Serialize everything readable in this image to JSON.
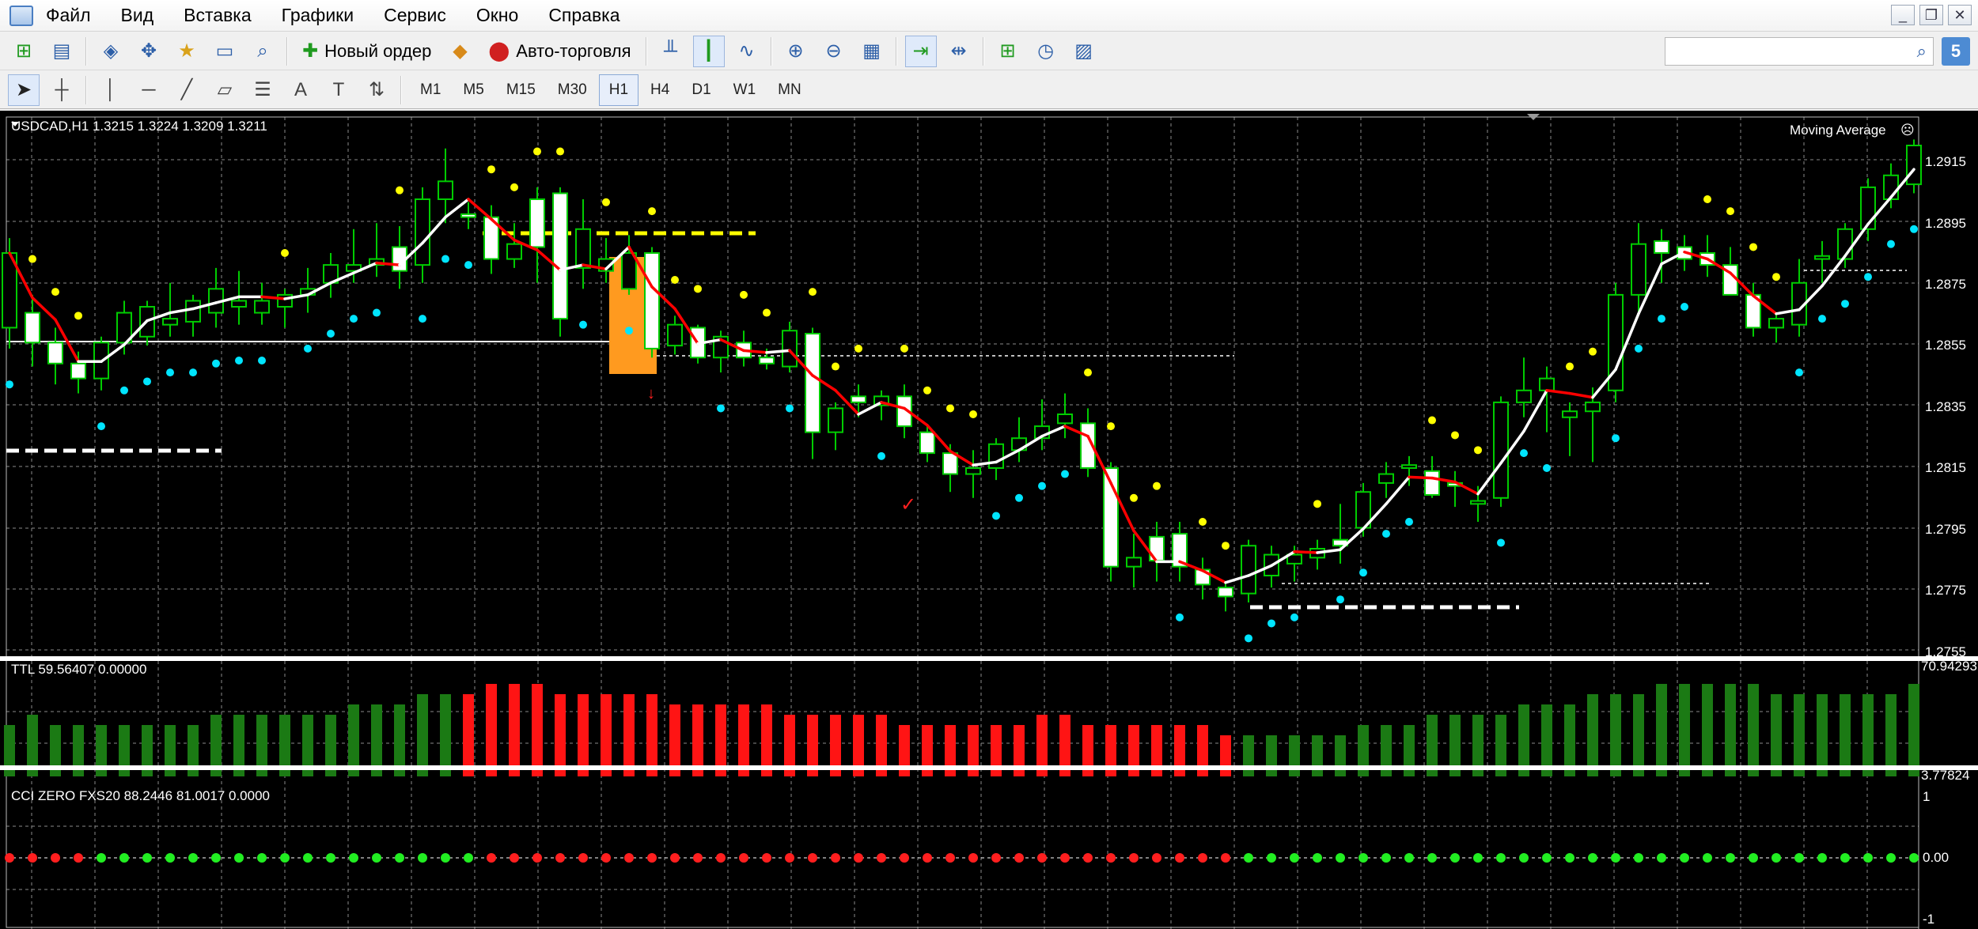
{
  "menu": [
    "Файл",
    "Вид",
    "Вставка",
    "Графики",
    "Сервис",
    "Окно",
    "Справка"
  ],
  "window_controls": [
    "_",
    "❐",
    "✕"
  ],
  "toolbar": {
    "new_order_label": "Новый ордер",
    "auto_trading_label": "Авто-торговля",
    "search_placeholder": "",
    "community_label": "5"
  },
  "timeframes": [
    "M1",
    "M5",
    "M15",
    "M30",
    "H1",
    "H4",
    "D1",
    "W1",
    "MN"
  ],
  "active_timeframe": "H1",
  "chart": {
    "info_label": "USDCAD,H1  1.3215 1.3224 1.3209 1.3211",
    "indicator_label": "Moving Average",
    "price_labels": [
      "1.2915",
      "1.2895",
      "1.2875",
      "1.2855",
      "1.2835",
      "1.2815",
      "1.2795",
      "1.2775",
      "1.2755"
    ],
    "ttl_label": "TTL 59.56407 0.00000",
    "ttl_scale_top": "70.94293",
    "ttl_scale_bottom": "3.77824",
    "cci_label": "CCI ZERO FXS20 88.2446 81.0017 0.0000",
    "cci_scale": [
      "1",
      "0.00",
      "-1"
    ]
  },
  "colors": {
    "bull_body": "#000000",
    "bear_body": "#ffffff",
    "candle_outline": "#00cc00",
    "ma_up": "#ffffff",
    "ma_down": "#ff0000",
    "psar_low": "#00e5ff",
    "psar_high": "#ffff00",
    "hist_green": "#1b7a14",
    "hist_red": "#ff1414",
    "highlight": "#ff9a1f",
    "grid": "#8a8a8a"
  },
  "chart_data": {
    "type": "candlestick",
    "symbol": "USDCAD",
    "timeframe": "H1",
    "price_range": [
      1.2745,
      1.2925
    ],
    "candles": [
      [
        1.2855,
        1.2885,
        1.2848,
        1.288
      ],
      [
        1.286,
        1.2866,
        1.2842,
        1.285
      ],
      [
        1.285,
        1.2855,
        1.2836,
        1.2843
      ],
      [
        1.2843,
        1.2847,
        1.2833,
        1.2838
      ],
      [
        1.2838,
        1.2852,
        1.2834,
        1.285
      ],
      [
        1.285,
        1.2864,
        1.2846,
        1.286
      ],
      [
        1.2852,
        1.2864,
        1.2849,
        1.2862
      ],
      [
        1.2856,
        1.287,
        1.2852,
        1.2858
      ],
      [
        1.2857,
        1.2866,
        1.2852,
        1.2864
      ],
      [
        1.286,
        1.2875,
        1.2855,
        1.2868
      ],
      [
        1.2862,
        1.2874,
        1.2856,
        1.2864
      ],
      [
        1.286,
        1.287,
        1.2856,
        1.2864
      ],
      [
        1.2862,
        1.2868,
        1.2855,
        1.2866
      ],
      [
        1.2866,
        1.2875,
        1.286,
        1.2868
      ],
      [
        1.287,
        1.288,
        1.2865,
        1.2876
      ],
      [
        1.2874,
        1.2888,
        1.287,
        1.2876
      ],
      [
        1.2876,
        1.289,
        1.2872,
        1.2878
      ],
      [
        1.2882,
        1.2889,
        1.2868,
        1.2874
      ],
      [
        1.2876,
        1.2902,
        1.287,
        1.2898
      ],
      [
        1.2898,
        1.2915,
        1.289,
        1.2904
      ],
      [
        1.2893,
        1.2897,
        1.2888,
        1.2892
      ],
      [
        1.2892,
        1.2896,
        1.2873,
        1.2878
      ],
      [
        1.2878,
        1.289,
        1.2875,
        1.2883
      ],
      [
        1.2898,
        1.2902,
        1.287,
        1.2882
      ],
      [
        1.29,
        1.2902,
        1.2852,
        1.2858
      ],
      [
        1.2875,
        1.2898,
        1.2868,
        1.2888
      ],
      [
        1.2874,
        1.2885,
        1.287,
        1.2878
      ],
      [
        1.2868,
        1.2886,
        1.2866,
        1.288
      ],
      [
        1.288,
        1.2882,
        1.2845,
        1.2848
      ],
      [
        1.2849,
        1.2859,
        1.2846,
        1.2856
      ],
      [
        1.2855,
        1.2856,
        1.2843,
        1.2845
      ],
      [
        1.2845,
        1.2854,
        1.284,
        1.2852
      ],
      [
        1.285,
        1.2854,
        1.2842,
        1.2845
      ],
      [
        1.2845,
        1.2848,
        1.2841,
        1.2843
      ],
      [
        1.2842,
        1.2857,
        1.284,
        1.2854
      ],
      [
        1.2853,
        1.2855,
        1.2811,
        1.282
      ],
      [
        1.282,
        1.283,
        1.2814,
        1.2828
      ],
      [
        1.2832,
        1.2836,
        1.2825,
        1.283
      ],
      [
        1.2829,
        1.2834,
        1.2824,
        1.2832
      ],
      [
        1.2832,
        1.2836,
        1.2818,
        1.2822
      ],
      [
        1.282,
        1.2822,
        1.281,
        1.2813
      ],
      [
        1.2813,
        1.2816,
        1.28,
        1.2806
      ],
      [
        1.2806,
        1.2814,
        1.2798,
        1.2808
      ],
      [
        1.2808,
        1.2818,
        1.2804,
        1.2816
      ],
      [
        1.2814,
        1.2825,
        1.281,
        1.2818
      ],
      [
        1.2818,
        1.2831,
        1.2814,
        1.2822
      ],
      [
        1.2823,
        1.2833,
        1.2818,
        1.2826
      ],
      [
        1.2823,
        1.2828,
        1.2805,
        1.2808
      ],
      [
        1.2808,
        1.281,
        1.277,
        1.2775
      ],
      [
        1.2775,
        1.2786,
        1.2768,
        1.2778
      ],
      [
        1.2785,
        1.279,
        1.277,
        1.2777
      ],
      [
        1.2786,
        1.279,
        1.277,
        1.2775
      ],
      [
        1.2774,
        1.2778,
        1.2764,
        1.2769
      ],
      [
        1.2768,
        1.277,
        1.276,
        1.2765
      ],
      [
        1.2766,
        1.2784,
        1.2763,
        1.2782
      ],
      [
        1.2772,
        1.2782,
        1.2768,
        1.2779
      ],
      [
        1.2776,
        1.2782,
        1.277,
        1.2779
      ],
      [
        1.2778,
        1.2784,
        1.2774,
        1.2781
      ],
      [
        1.2784,
        1.2796,
        1.2776,
        1.2782
      ],
      [
        1.2788,
        1.2803,
        1.2785,
        1.28
      ],
      [
        1.2803,
        1.281,
        1.2798,
        1.2806
      ],
      [
        1.2808,
        1.2812,
        1.2802,
        1.2809
      ],
      [
        1.2807,
        1.2812,
        1.2798,
        1.2799
      ],
      [
        1.2803,
        1.2807,
        1.2795,
        1.2802
      ],
      [
        1.2796,
        1.2802,
        1.279,
        1.2797
      ],
      [
        1.2798,
        1.2832,
        1.2795,
        1.283
      ],
      [
        1.283,
        1.2845,
        1.2825,
        1.2834
      ],
      [
        1.2834,
        1.2842,
        1.282,
        1.2838
      ],
      [
        1.2825,
        1.283,
        1.2812,
        1.2827
      ],
      [
        1.2827,
        1.2835,
        1.281,
        1.283
      ],
      [
        1.2834,
        1.287,
        1.283,
        1.2866
      ],
      [
        1.2866,
        1.289,
        1.286,
        1.2883
      ],
      [
        1.2884,
        1.2888,
        1.287,
        1.288
      ],
      [
        1.2882,
        1.2886,
        1.2874,
        1.2878
      ],
      [
        1.288,
        1.2886,
        1.2872,
        1.2876
      ],
      [
        1.2876,
        1.2882,
        1.2866,
        1.2866
      ],
      [
        1.2866,
        1.287,
        1.2852,
        1.2855
      ],
      [
        1.2855,
        1.286,
        1.285,
        1.2858
      ],
      [
        1.2856,
        1.2878,
        1.2852,
        1.287
      ],
      [
        1.2878,
        1.2884,
        1.287,
        1.2879
      ],
      [
        1.2878,
        1.289,
        1.2875,
        1.2888
      ],
      [
        1.2888,
        1.2905,
        1.2884,
        1.2902
      ],
      [
        1.2898,
        1.291,
        1.2895,
        1.2906
      ],
      [
        1.2903,
        1.2918,
        1.29,
        1.2916
      ]
    ],
    "ttl_histogram": [
      5,
      6,
      5,
      5,
      5,
      5,
      5,
      5,
      5,
      6,
      6,
      6,
      6,
      6,
      6,
      7,
      7,
      7,
      8,
      8,
      8,
      9,
      9,
      9,
      8,
      8,
      8,
      8,
      8,
      7,
      7,
      7,
      7,
      7,
      6,
      6,
      6,
      6,
      6,
      5,
      5,
      5,
      5,
      5,
      5,
      6,
      6,
      5,
      5,
      5,
      5,
      5,
      5,
      4,
      4,
      4,
      4,
      4,
      4,
      5,
      5,
      5,
      6,
      6,
      6,
      6,
      7,
      7,
      7,
      8,
      8,
      8,
      9,
      9,
      9,
      9,
      9,
      8,
      8,
      8,
      8,
      8,
      8,
      9
    ],
    "ttl_red_range": [
      20,
      53
    ],
    "cci_dot_colors": [
      "r",
      "r",
      "r",
      "r",
      "g",
      "g",
      "g",
      "g",
      "g",
      "g",
      "g",
      "g",
      "g",
      "g",
      "g",
      "g",
      "g",
      "g",
      "g",
      "g",
      "g",
      "r",
      "r",
      "r",
      "r",
      "r",
      "r",
      "r",
      "r",
      "r",
      "r",
      "r",
      "r",
      "r",
      "r",
      "r",
      "r",
      "r",
      "r",
      "r",
      "r",
      "r",
      "r",
      "r",
      "r",
      "r",
      "r",
      "r",
      "r",
      "r",
      "r",
      "r",
      "r",
      "r",
      "g",
      "g",
      "g",
      "g",
      "g",
      "g",
      "g",
      "g",
      "g",
      "g",
      "g",
      "g",
      "g",
      "g",
      "g",
      "g",
      "g",
      "g",
      "g",
      "g",
      "g",
      "g",
      "g",
      "g",
      "g",
      "g",
      "g",
      "g",
      "g",
      "g"
    ]
  }
}
